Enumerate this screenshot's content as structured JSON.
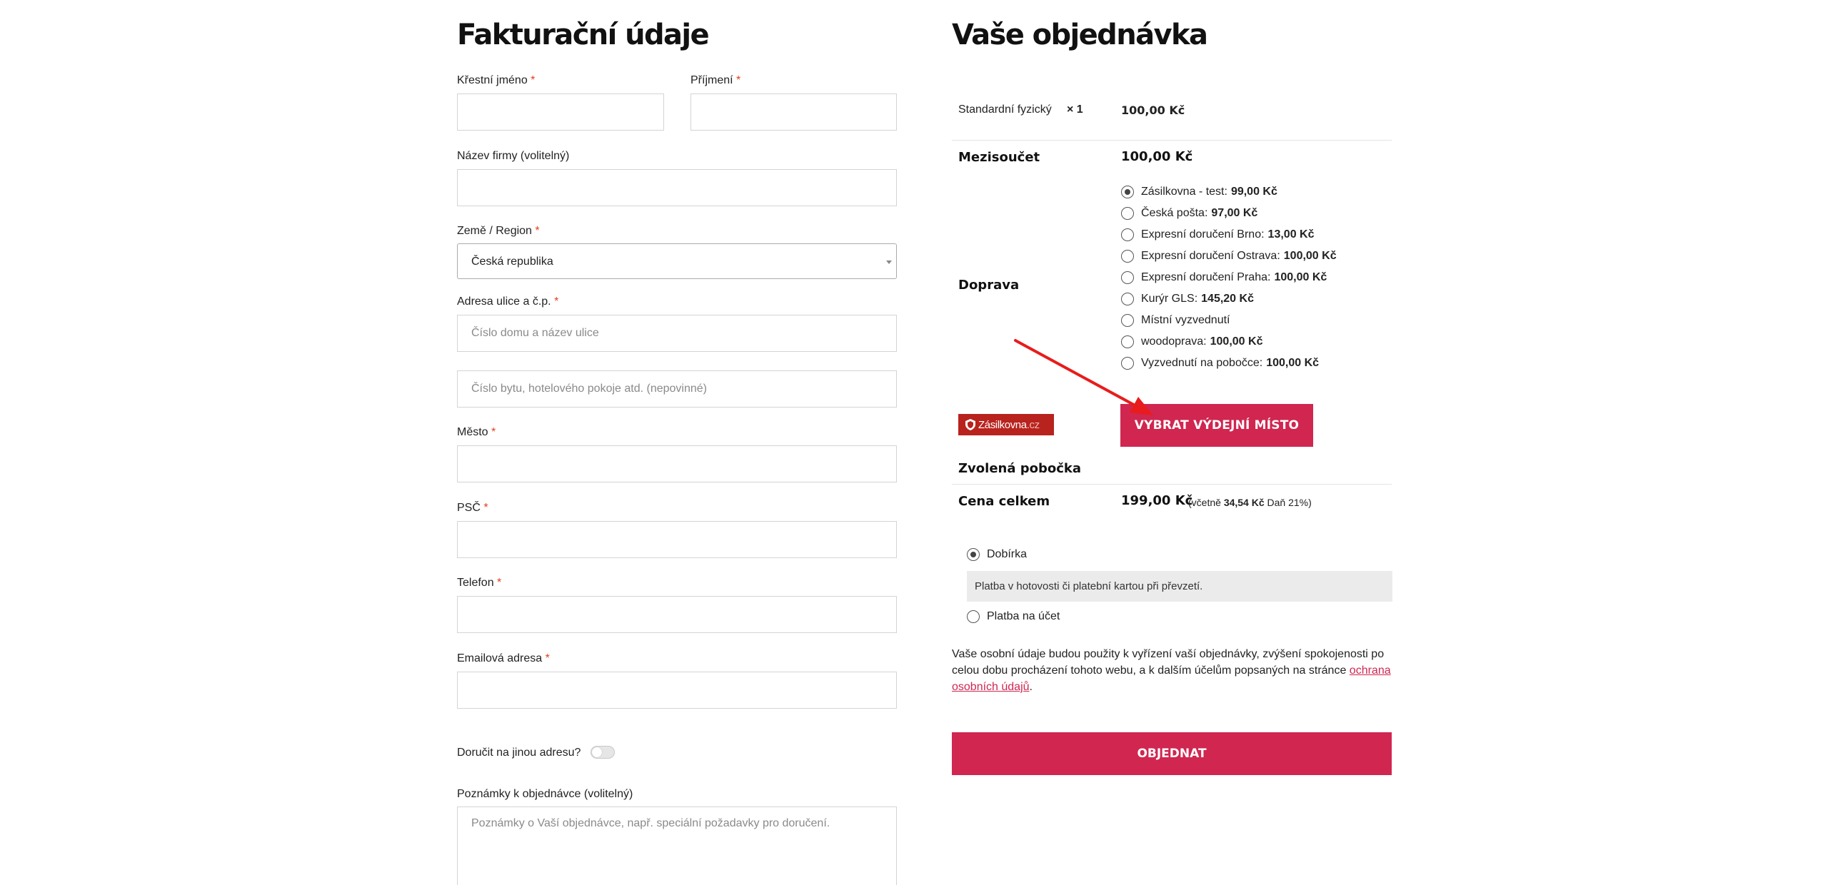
{
  "billing": {
    "heading": "Fakturační údaje",
    "first_name": {
      "label": "Křestní jméno",
      "req": "*"
    },
    "last_name": {
      "label": "Příjmení",
      "req": "*"
    },
    "company": {
      "label": "Název firmy (volitelný)"
    },
    "country": {
      "label": "Země / Region",
      "req": "*",
      "value": "Česká republika"
    },
    "address": {
      "label": "Adresa ulice a č.p.",
      "req": "*",
      "placeholder1": "Číslo domu a název ulice",
      "placeholder2": "Číslo bytu, hotelového pokoje atd. (nepovinné)"
    },
    "city": {
      "label": "Město",
      "req": "*"
    },
    "zip": {
      "label": "PSČ",
      "req": "*"
    },
    "phone": {
      "label": "Telefon",
      "req": "*"
    },
    "email": {
      "label": "Emailová adresa",
      "req": "*"
    },
    "ship_different": {
      "label": "Doručit na jinou adresu?",
      "enabled": false
    },
    "notes": {
      "label": "Poznámky k objednávce (volitelný)",
      "placeholder": "Poznámky o Vaší objednávce, např. speciální požadavky pro doručení."
    }
  },
  "order": {
    "heading": "Vaše objednávka",
    "item": {
      "name": "Standardní fyzický",
      "qty": "× 1",
      "price": "100,00 Kč"
    },
    "subtotal": {
      "label": "Mezisoučet",
      "value": "100,00 Kč"
    },
    "shipping": {
      "label": "Doprava",
      "options": [
        {
          "name": "Zásilkovna - test:",
          "price": "99,00 Kč",
          "selected": true
        },
        {
          "name": "Česká pošta:",
          "price": "97,00 Kč",
          "selected": false
        },
        {
          "name": "Expresní doručení Brno:",
          "price": "13,00 Kč",
          "selected": false
        },
        {
          "name": "Expresní doručení Ostrava:",
          "price": "100,00 Kč",
          "selected": false
        },
        {
          "name": "Expresní doručení Praha:",
          "price": "100,00 Kč",
          "selected": false
        },
        {
          "name": "Kurýr GLS:",
          "price": "145,20 Kč",
          "selected": false
        },
        {
          "name": "Místní vyzvednutí",
          "price": "",
          "selected": false
        },
        {
          "name": "woodoprava:",
          "price": "100,00 Kč",
          "selected": false
        },
        {
          "name": "Vyzvednutí na pobočce:",
          "price": "100,00 Kč",
          "selected": false
        }
      ]
    },
    "zasilkovna": {
      "logo_text": "Zásilkovna",
      "logo_tld": ".cz",
      "button": "VYBRAT VÝDEJNÍ MÍSTO"
    },
    "pickup": {
      "label": "Zvolená pobočka"
    },
    "total": {
      "label": "Cena celkem",
      "value": "199,00 Kč",
      "tax_prefix": "(včetně",
      "tax_value": "34,54 Kč",
      "tax_suffix": "Daň 21%)"
    },
    "payment": [
      {
        "label": "Dobírka",
        "selected": true,
        "description": "Platba v hotovosti či platební kartou při převzetí."
      },
      {
        "label": "Platba na účet",
        "selected": false
      }
    ],
    "privacy": {
      "text": "Vaše osobní údaje budou použity k vyřízení vaší objednávky, zvýšení spokojenosti po celou dobu procházení tohoto webu, a k dalším účelům popsaných na stránce",
      "link": "ochrana osobních údajů",
      "end": "."
    },
    "submit": "OBJEDNAT"
  },
  "colors": {
    "accent": "#d02650",
    "zasilkovna_red": "#b8231e",
    "annotation_arrow": "#e81c1c"
  }
}
